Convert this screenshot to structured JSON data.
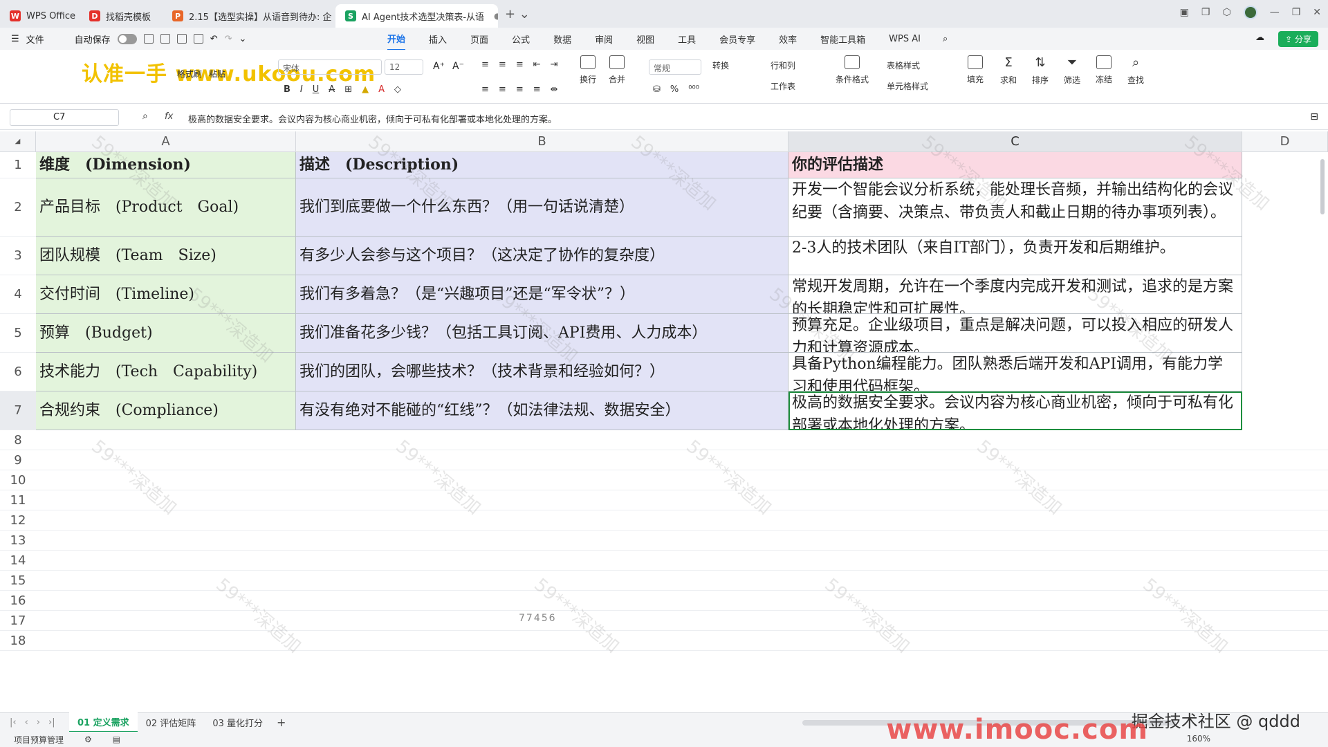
{
  "tabs": [
    {
      "label": "WPS Office",
      "icon": "wps-logo-icon",
      "color": "#e4312b",
      "active": false
    },
    {
      "label": "找稻壳模板",
      "icon": "docer-icon",
      "color": "#e4312b",
      "active": false
    },
    {
      "label": "2.15【选型实操】从语音到待办: 企",
      "icon": "ppt-icon",
      "color": "#e86628",
      "active": false
    },
    {
      "label": "AI Agent技术选型决策表-从语",
      "icon": "sheet-icon",
      "color": "#1aa260",
      "active": true
    }
  ],
  "menu": {
    "file": "文件",
    "autosave": "自动保存",
    "items": [
      "开始",
      "插入",
      "页面",
      "公式",
      "数据",
      "审阅",
      "视图",
      "工具",
      "会员专享",
      "效率",
      "智能工具箱",
      "WPS AI"
    ],
    "active": "开始",
    "share": "分享"
  },
  "ribbon": {
    "watermark": "认准一手 www.ukoou.com",
    "groups": [
      "格式刷",
      "粘贴",
      "换行",
      "合并",
      "转换",
      "行和列",
      "工作表",
      "条件格式",
      "表格样式",
      "单元格样式",
      "填充",
      "求和",
      "排序",
      "筛选",
      "冻结",
      "查找"
    ],
    "font_name": "宋体",
    "font_size": "12",
    "number_format": "常规"
  },
  "formula_bar": {
    "cell_ref": "C7",
    "fx": "fx",
    "content": "极高的数据安全要求。会议内容为核心商业机密，倾向于可私有化部署或本地化处理的方案。"
  },
  "columns": [
    "A",
    "B",
    "C",
    "D"
  ],
  "row_numbers": [
    "1",
    "2",
    "3",
    "4",
    "5",
    "6",
    "7",
    "8",
    "9",
    "10",
    "11",
    "12",
    "13",
    "14",
    "15",
    "16",
    "17",
    "18"
  ],
  "table": [
    {
      "a": "维度　(Dimension)",
      "b": "描述　(Description)",
      "c": "你的评估描述"
    },
    {
      "a": "产品目标　(Product　Goal)",
      "b": "我们到底要做一个什么东西？（用一句话说清楚）",
      "c": "开发一个智能会议分析系统，能处理长音频，并输出结构化的会议纪要（含摘要、决策点、带负责人和截止日期的待办事项列表）。"
    },
    {
      "a": "团队规模　(Team　Size)",
      "b": "有多少人会参与这个项目？（这决定了协作的复杂度）",
      "c": "2-3人的技术团队（来自IT部门），负责开发和后期维护。"
    },
    {
      "a": "交付时间　(Timeline)",
      "b": "我们有多着急？（是“兴趣项目”还是“军令状”？）",
      "c": "常规开发周期，允许在一个季度内完成开发和测试，追求的是方案的长期稳定性和可扩展性。"
    },
    {
      "a": "预算　(Budget)",
      "b": "我们准备花多少钱？（包括工具订阅、API费用、人力成本）",
      "c": "预算充足。企业级项目，重点是解决问题，可以投入相应的研发人力和计算资源成本。"
    },
    {
      "a": "技术能力　(Tech　Capability)",
      "b": "我们的团队，会哪些技术？（技术背景和经验如何？）",
      "c": "具备Python编程能力。团队熟悉后端开发和API调用，有能力学习和使用代码框架。"
    },
    {
      "a": "合规约束　(Compliance)",
      "b": "有没有绝对不能碰的“红线”？（如法律法规、数据安全）",
      "c": "极高的数据安全要求。会议内容为核心商业机密，倾向于可私有化部署或本地化处理的方案。"
    }
  ],
  "sheets": [
    "01 定义需求",
    "02 评估矩阵",
    "03 量化打分"
  ],
  "active_sheet": "01 定义需求",
  "status": {
    "left": "项目预算管理",
    "zoom": "160%"
  },
  "overlay": {
    "watermark": "59***深造加",
    "credit": "掘金技术社区 @ qddd",
    "imooc": "www.imooc.com",
    "faint_number": "77456"
  },
  "colors": {
    "col_a": "#e3f4dc",
    "col_b": "#e2e3f6",
    "header_c": "#fbd9e3",
    "accent": "#1a73e8",
    "sheet_green": "#1aa260"
  }
}
